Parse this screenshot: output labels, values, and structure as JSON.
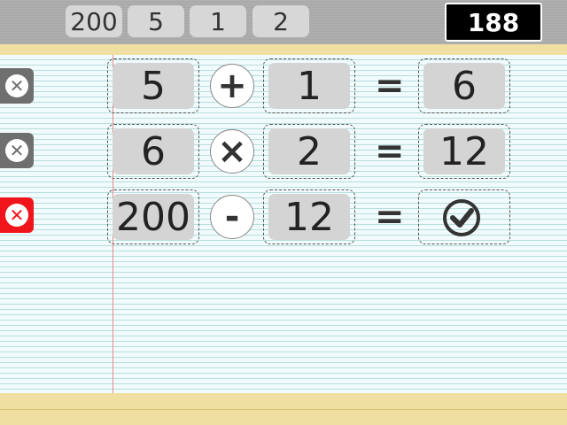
{
  "numbers": [
    "200",
    "5",
    "1",
    "2"
  ],
  "target": "188",
  "rows": [
    {
      "a": "5",
      "op": "+",
      "b": "1",
      "eq": "=",
      "result": "6"
    },
    {
      "a": "6",
      "op": "×",
      "b": "2",
      "eq": "=",
      "result": "12"
    },
    {
      "a": "200",
      "op": "-",
      "b": "12",
      "eq": "=",
      "result": ""
    }
  ],
  "icons": {
    "delete": "close-circle-icon",
    "confirm": "checkmark-icon"
  },
  "colors": {
    "delete_active": "#f0141b",
    "delete_inactive": "#6f6f6f",
    "paper_margin": "#e88b8b"
  }
}
